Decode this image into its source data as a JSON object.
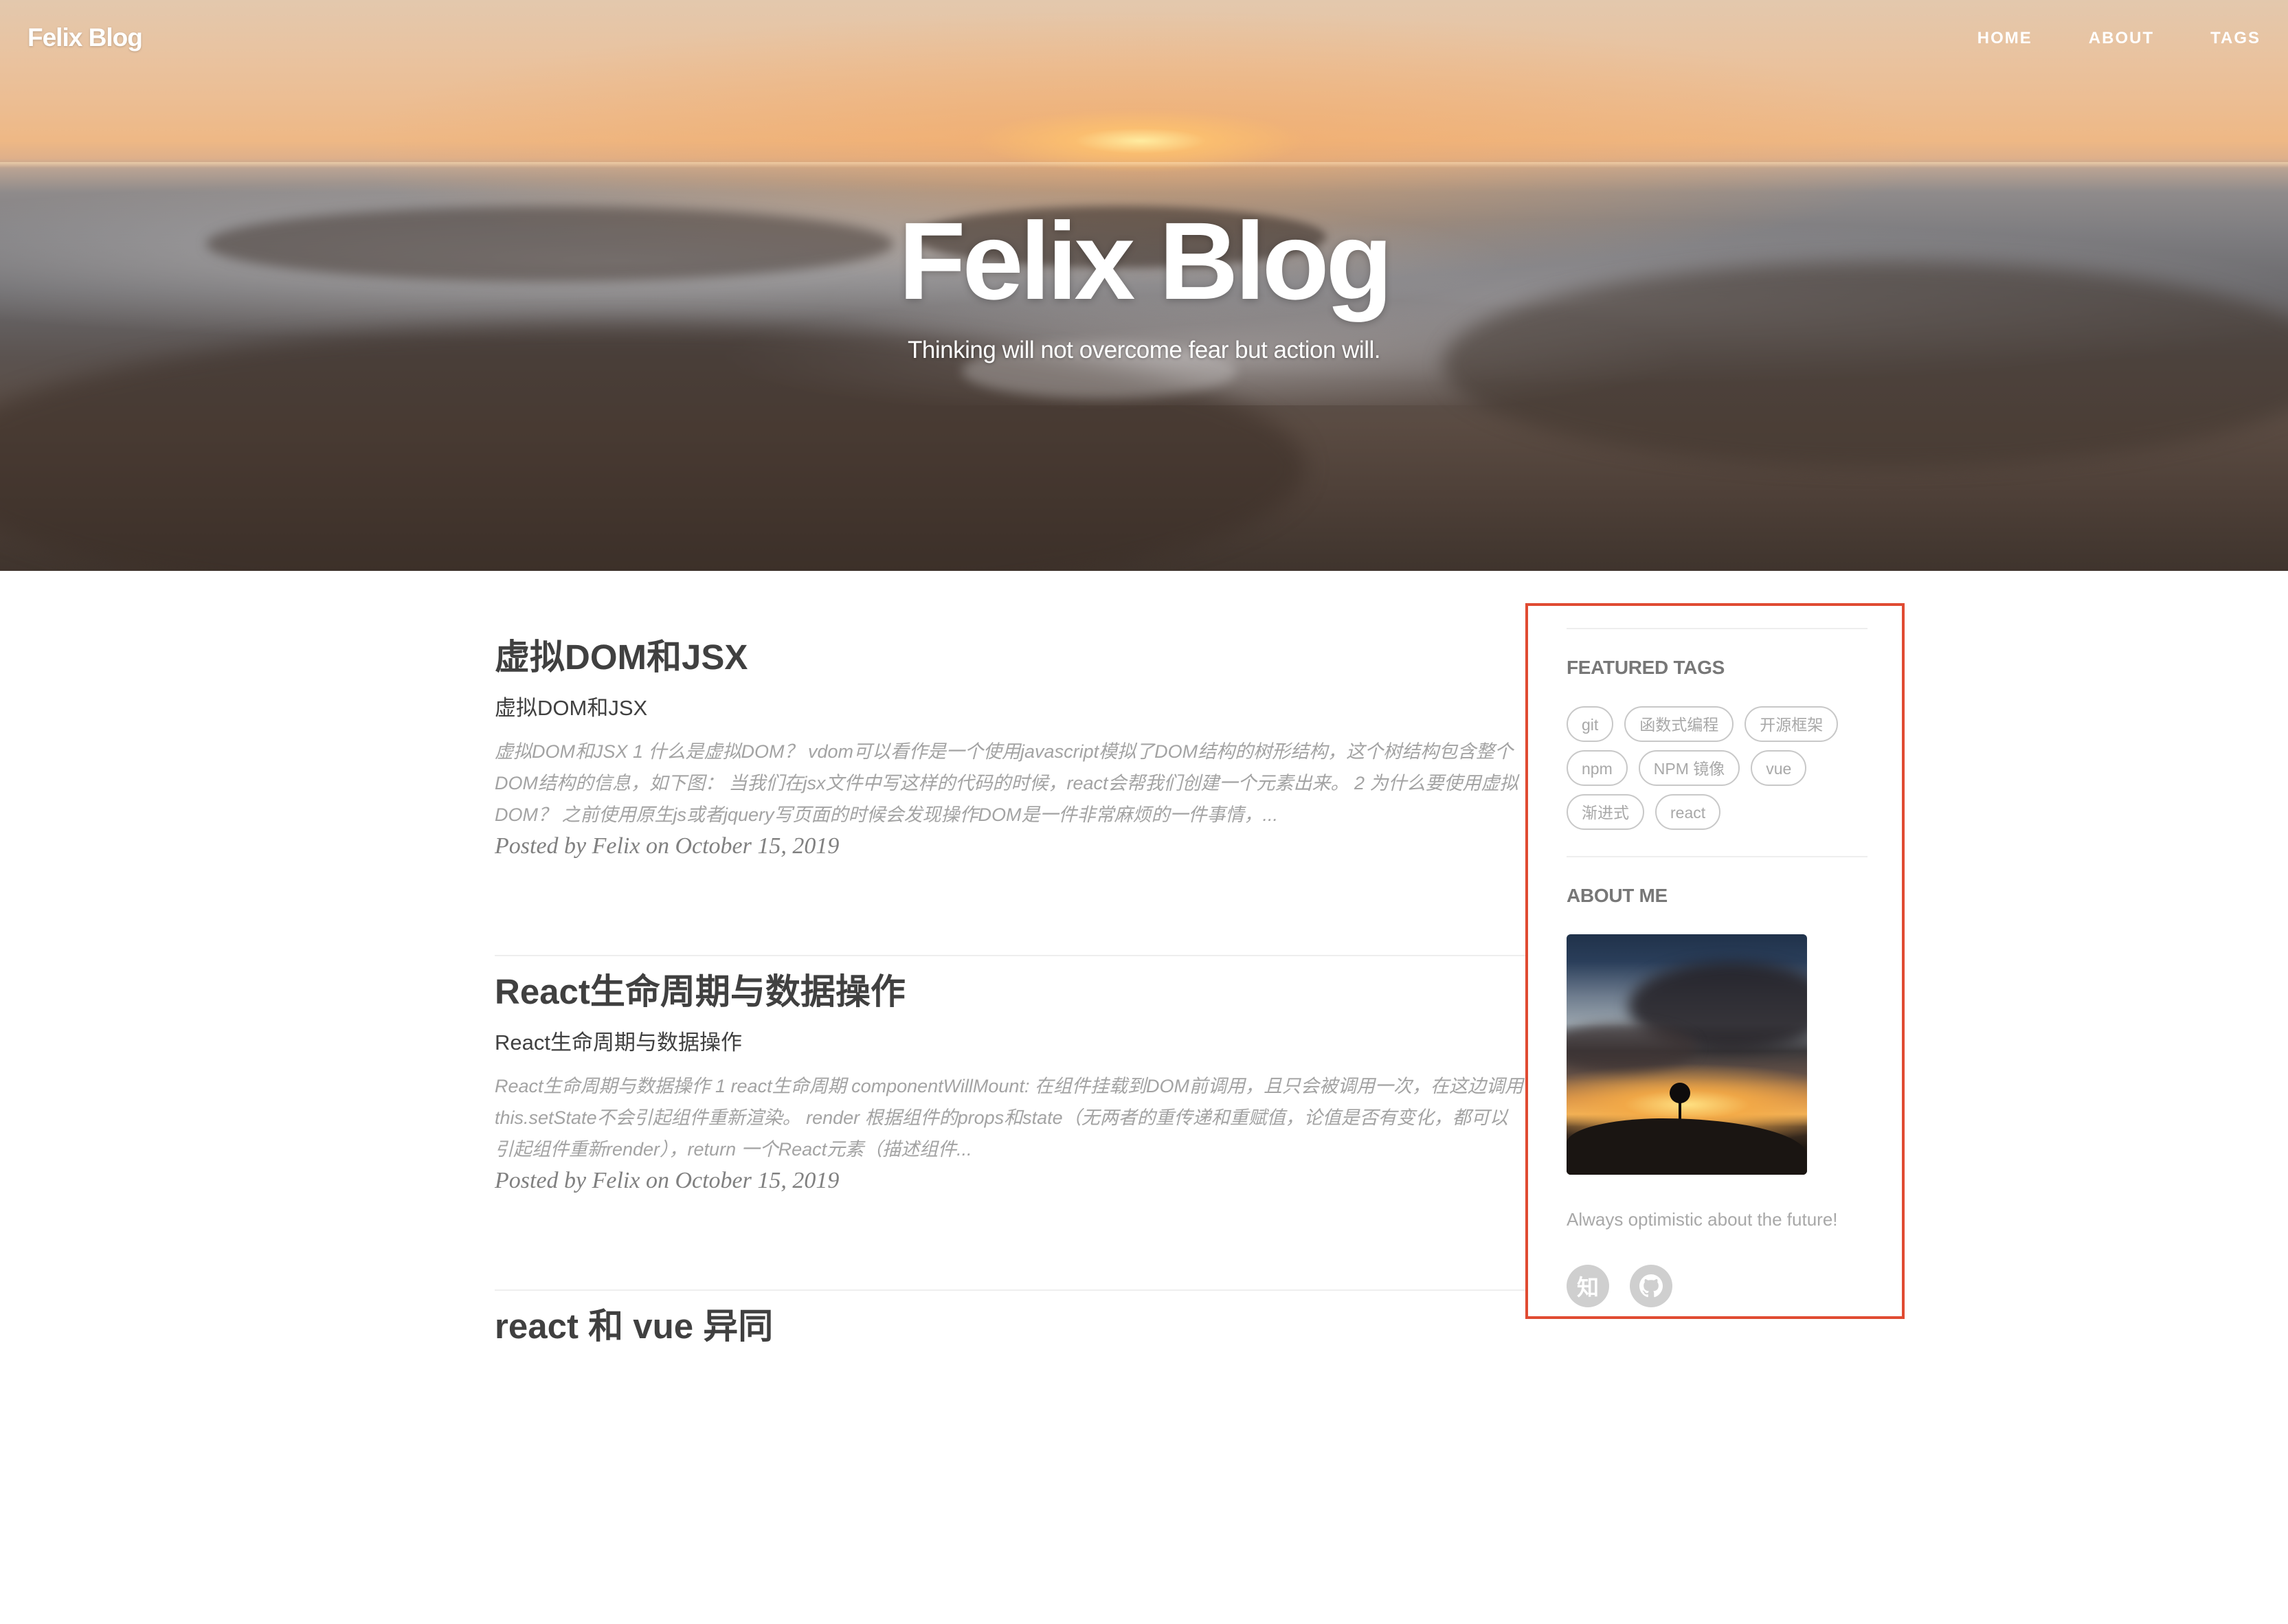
{
  "header": {
    "brand": "Felix Blog",
    "nav": [
      {
        "label": "HOME"
      },
      {
        "label": "ABOUT"
      },
      {
        "label": "TAGS"
      }
    ],
    "title": "Felix Blog",
    "subtitle": "Thinking will not overcome fear but action will."
  },
  "posts": [
    {
      "title": "虚拟DOM和JSX",
      "subtitle": "虚拟DOM和JSX",
      "excerpt": "虚拟DOM和JSX 1 什么是虚拟DOM？ vdom可以看作是一个使用javascript模拟了DOM结构的树形结构，这个树结构包含整个DOM结构的信息，如下图： 当我们在jsx文件中写这样的代码的时候，react会帮我们创建一个元素出来。 2 为什么要使用虚拟DOM？ 之前使用原生js或者jquery写页面的时候会发现操作DOM是一件非常麻烦的一件事情，...",
      "meta": "Posted by Felix on October 15, 2019"
    },
    {
      "title": "React生命周期与数据操作",
      "subtitle": "React生命周期与数据操作",
      "excerpt": "React生命周期与数据操作 1 react生命周期 componentWillMount: 在组件挂载到DOM前调用，且只会被调用一次，在这边调用this.setState不会引起组件重新渲染。 render 根据组件的props和state（无两者的重传递和重赋值，论值是否有变化，都可以引起组件重新render），return 一个React元素（描述组件...",
      "meta": "Posted by Felix on October 15, 2019"
    },
    {
      "title": "react 和 vue 异同"
    }
  ],
  "sidebar": {
    "featured_tags_heading": "FEATURED TAGS",
    "tags": [
      "git",
      "函数式编程",
      "开源框架",
      "npm",
      "NPM 镜像",
      "vue",
      "渐进式",
      "react"
    ],
    "about_heading": "ABOUT ME",
    "about_text": "Always optimistic about the future!",
    "socials": [
      {
        "name": "zhihu",
        "glyph": "知"
      },
      {
        "name": "github",
        "glyph": ""
      }
    ]
  },
  "colors": {
    "highlight_border": "#e04b32",
    "tag_border": "#c8c8c8",
    "text_dark": "#404040",
    "text_muted": "#a3a3a3"
  }
}
